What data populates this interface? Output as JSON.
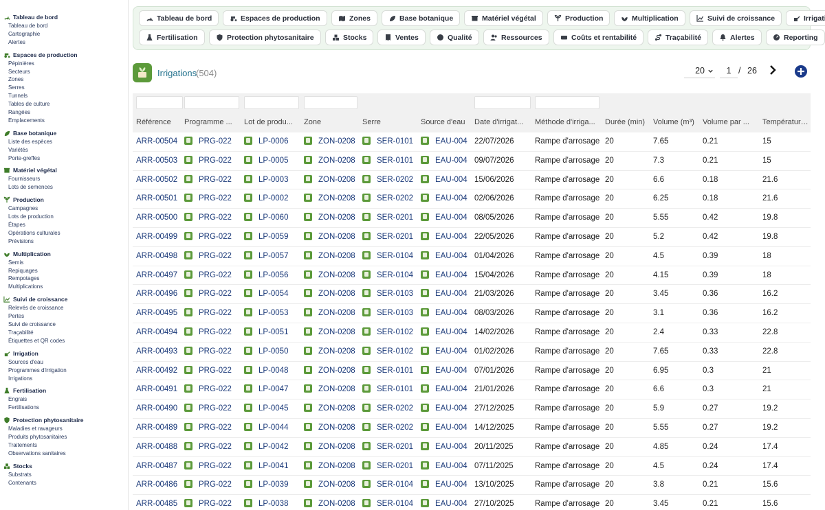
{
  "sidebar": [
    {
      "label": "Tableau de bord",
      "icon": "dashboard-icon",
      "items": [
        "Tableau de bord",
        "Cartographie",
        "Alertes"
      ]
    },
    {
      "label": "Espaces de production",
      "icon": "tractor-icon",
      "items": [
        "Pépinières",
        "Secteurs",
        "Zones",
        "Serres",
        "Tunnels",
        "Tables de culture",
        "Rangées",
        "Emplacements"
      ]
    },
    {
      "label": "Base botanique",
      "icon": "leaf-icon",
      "items": [
        "Liste des espèces",
        "Variétés",
        "Porte-greffes"
      ]
    },
    {
      "label": "Matériel végétal",
      "icon": "box-icon",
      "items": [
        "Fournisseurs",
        "Lots de semences"
      ]
    },
    {
      "label": "Production",
      "icon": "seedling-icon",
      "items": [
        "Campagnes",
        "Lots de production",
        "Étapes",
        "Opérations culturales",
        "Prévisions"
      ]
    },
    {
      "label": "Multiplication",
      "icon": "plant-icon",
      "items": [
        "Semis",
        "Repiquages",
        "Rempotages",
        "Multiplications"
      ]
    },
    {
      "label": "Suivi de croissance",
      "icon": "chart-icon",
      "items": [
        "Relevés de croissance",
        "Pertes",
        "Suivi de croissance",
        "Traçabilité",
        "Étiquettes et QR codes"
      ]
    },
    {
      "label": "Irrigation",
      "icon": "watering-icon",
      "items": [
        "Sources d'eau",
        "Programmes d'irrigation",
        "Irrigations"
      ]
    },
    {
      "label": "Fertilisation",
      "icon": "flask-icon",
      "items": [
        "Engrais",
        "Fertilisations"
      ]
    },
    {
      "label": "Protection phytosanitaire",
      "icon": "shield-icon",
      "items": [
        "Maladies et ravageurs",
        "Produits phytosanitaires",
        "Traitements",
        "Observations sanitaires"
      ]
    },
    {
      "label": "Stocks",
      "icon": "boxes-icon",
      "items": [
        "Substrats",
        "Contenants"
      ]
    }
  ],
  "nav": {
    "row1": [
      {
        "label": "Tableau de bord",
        "icon": "dashboard-icon"
      },
      {
        "label": "Espaces de production",
        "icon": "tractor-icon"
      },
      {
        "label": "Zones",
        "icon": "map-icon"
      },
      {
        "label": "Base botanique",
        "icon": "leaf-icon"
      },
      {
        "label": "Matériel végétal",
        "icon": "box-icon"
      },
      {
        "label": "Production",
        "icon": "seedling-icon"
      },
      {
        "label": "Multiplication",
        "icon": "plant-icon"
      },
      {
        "label": "Suivi de croissance",
        "icon": "chart-icon"
      },
      {
        "label": "Irrigation",
        "icon": "watering-icon"
      }
    ],
    "row2": [
      {
        "label": "Fertilisation",
        "icon": "flask-icon"
      },
      {
        "label": "Protection phytosanitaire",
        "icon": "shield-icon"
      },
      {
        "label": "Stocks",
        "icon": "boxes-icon"
      },
      {
        "label": "Ventes",
        "icon": "receipt-icon"
      },
      {
        "label": "Qualité",
        "icon": "badge-icon"
      },
      {
        "label": "Ressources",
        "icon": "users-icon"
      },
      {
        "label": "Coûts et rentabilité",
        "icon": "money-icon"
      },
      {
        "label": "Traçabilité",
        "icon": "route-icon"
      },
      {
        "label": "Alertes",
        "icon": "bell-icon"
      },
      {
        "label": "Reporting",
        "icon": "gauge-icon"
      }
    ]
  },
  "header": {
    "title": "Irrigations",
    "count": "(504)"
  },
  "pager": {
    "page_size": "20",
    "page": "1",
    "separator": "/",
    "total_pages": "26"
  },
  "table": {
    "columns": [
      "Référence",
      "Programme ...",
      "Lot de produ...",
      "Zone",
      "Serre",
      "Source d'eau",
      "Date d'irrigat...",
      "Méthode d'irriga...",
      "Durée (min)",
      "Volume (m³)",
      "Volume par ...",
      "Température..."
    ],
    "rows": [
      [
        "ARR-00504",
        "PRG-022",
        "LP-0006",
        "ZON-0208",
        "SER-0101",
        "EAU-004",
        "22/07/2026",
        "Rampe d'arrosage",
        "20",
        "7.65",
        "0.21",
        "15"
      ],
      [
        "ARR-00503",
        "PRG-022",
        "LP-0005",
        "ZON-0208",
        "SER-0101",
        "EAU-004",
        "09/07/2026",
        "Rampe d'arrosage",
        "20",
        "7.3",
        "0.21",
        "15"
      ],
      [
        "ARR-00502",
        "PRG-022",
        "LP-0003",
        "ZON-0208",
        "SER-0202",
        "EAU-004",
        "15/06/2026",
        "Rampe d'arrosage",
        "20",
        "6.6",
        "0.18",
        "21.6"
      ],
      [
        "ARR-00501",
        "PRG-022",
        "LP-0002",
        "ZON-0208",
        "SER-0202",
        "EAU-004",
        "02/06/2026",
        "Rampe d'arrosage",
        "20",
        "6.25",
        "0.18",
        "21.6"
      ],
      [
        "ARR-00500",
        "PRG-022",
        "LP-0060",
        "ZON-0208",
        "SER-0201",
        "EAU-004",
        "08/05/2026",
        "Rampe d'arrosage",
        "20",
        "5.55",
        "0.42",
        "19.8"
      ],
      [
        "ARR-00499",
        "PRG-022",
        "LP-0059",
        "ZON-0208",
        "SER-0201",
        "EAU-004",
        "22/05/2026",
        "Rampe d'arrosage",
        "20",
        "5.2",
        "0.42",
        "19.8"
      ],
      [
        "ARR-00498",
        "PRG-022",
        "LP-0057",
        "ZON-0208",
        "SER-0104",
        "EAU-004",
        "01/04/2026",
        "Rampe d'arrosage",
        "20",
        "4.5",
        "0.39",
        "18"
      ],
      [
        "ARR-00497",
        "PRG-022",
        "LP-0056",
        "ZON-0208",
        "SER-0104",
        "EAU-004",
        "15/04/2026",
        "Rampe d'arrosage",
        "20",
        "4.15",
        "0.39",
        "18"
      ],
      [
        "ARR-00496",
        "PRG-022",
        "LP-0054",
        "ZON-0208",
        "SER-0103",
        "EAU-004",
        "21/03/2026",
        "Rampe d'arrosage",
        "20",
        "3.45",
        "0.36",
        "16.2"
      ],
      [
        "ARR-00495",
        "PRG-022",
        "LP-0053",
        "ZON-0208",
        "SER-0103",
        "EAU-004",
        "08/03/2026",
        "Rampe d'arrosage",
        "20",
        "3.1",
        "0.36",
        "16.2"
      ],
      [
        "ARR-00494",
        "PRG-022",
        "LP-0051",
        "ZON-0208",
        "SER-0102",
        "EAU-004",
        "14/02/2026",
        "Rampe d'arrosage",
        "20",
        "2.4",
        "0.33",
        "22.8"
      ],
      [
        "ARR-00493",
        "PRG-022",
        "LP-0050",
        "ZON-0208",
        "SER-0102",
        "EAU-004",
        "01/02/2026",
        "Rampe d'arrosage",
        "20",
        "7.65",
        "0.33",
        "22.8"
      ],
      [
        "ARR-00492",
        "PRG-022",
        "LP-0048",
        "ZON-0208",
        "SER-0101",
        "EAU-004",
        "07/01/2026",
        "Rampe d'arrosage",
        "20",
        "6.95",
        "0.3",
        "21"
      ],
      [
        "ARR-00491",
        "PRG-022",
        "LP-0047",
        "ZON-0208",
        "SER-0101",
        "EAU-004",
        "21/01/2026",
        "Rampe d'arrosage",
        "20",
        "6.6",
        "0.3",
        "21"
      ],
      [
        "ARR-00490",
        "PRG-022",
        "LP-0045",
        "ZON-0208",
        "SER-0202",
        "EAU-004",
        "27/12/2025",
        "Rampe d'arrosage",
        "20",
        "5.9",
        "0.27",
        "19.2"
      ],
      [
        "ARR-00489",
        "PRG-022",
        "LP-0044",
        "ZON-0208",
        "SER-0202",
        "EAU-004",
        "14/12/2025",
        "Rampe d'arrosage",
        "20",
        "5.55",
        "0.27",
        "19.2"
      ],
      [
        "ARR-00488",
        "PRG-022",
        "LP-0042",
        "ZON-0208",
        "SER-0201",
        "EAU-004",
        "20/11/2025",
        "Rampe d'arrosage",
        "20",
        "4.85",
        "0.24",
        "17.4"
      ],
      [
        "ARR-00487",
        "PRG-022",
        "LP-0041",
        "ZON-0208",
        "SER-0201",
        "EAU-004",
        "07/11/2025",
        "Rampe d'arrosage",
        "20",
        "4.5",
        "0.24",
        "17.4"
      ],
      [
        "ARR-00486",
        "PRG-022",
        "LP-0039",
        "ZON-0208",
        "SER-0104",
        "EAU-004",
        "13/10/2025",
        "Rampe d'arrosage",
        "20",
        "3.8",
        "0.21",
        "15.6"
      ],
      [
        "ARR-00485",
        "PRG-022",
        "LP-0038",
        "ZON-0208",
        "SER-0104",
        "EAU-004",
        "27/10/2025",
        "Rampe d'arrosage",
        "20",
        "3.45",
        "0.21",
        "15.6"
      ]
    ]
  },
  "colors": {
    "accent": "#5c9a3a",
    "link": "#1b3a7a",
    "title": "#1f6f8b",
    "nav_bg": "#eef6ee",
    "add_button": "#1a3a8a"
  }
}
